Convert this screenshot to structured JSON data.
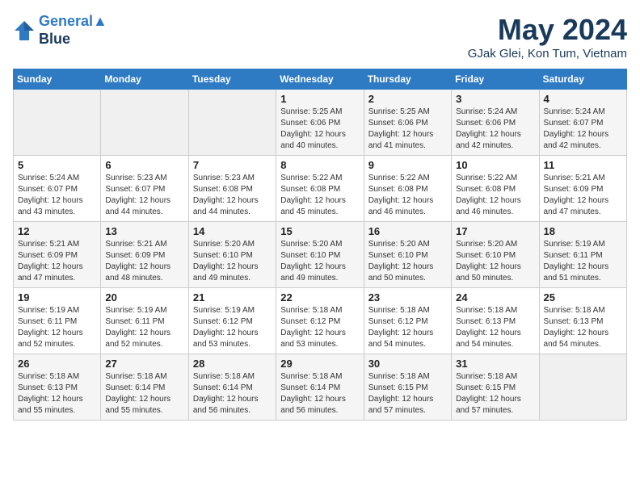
{
  "header": {
    "logo_line1": "General",
    "logo_line2": "Blue",
    "month": "May 2024",
    "location": "GJak Glei, Kon Tum, Vietnam"
  },
  "weekdays": [
    "Sunday",
    "Monday",
    "Tuesday",
    "Wednesday",
    "Thursday",
    "Friday",
    "Saturday"
  ],
  "weeks": [
    [
      {
        "day": "",
        "info": ""
      },
      {
        "day": "",
        "info": ""
      },
      {
        "day": "",
        "info": ""
      },
      {
        "day": "1",
        "info": "Sunrise: 5:25 AM\nSunset: 6:06 PM\nDaylight: 12 hours\nand 40 minutes."
      },
      {
        "day": "2",
        "info": "Sunrise: 5:25 AM\nSunset: 6:06 PM\nDaylight: 12 hours\nand 41 minutes."
      },
      {
        "day": "3",
        "info": "Sunrise: 5:24 AM\nSunset: 6:06 PM\nDaylight: 12 hours\nand 42 minutes."
      },
      {
        "day": "4",
        "info": "Sunrise: 5:24 AM\nSunset: 6:07 PM\nDaylight: 12 hours\nand 42 minutes."
      }
    ],
    [
      {
        "day": "5",
        "info": "Sunrise: 5:24 AM\nSunset: 6:07 PM\nDaylight: 12 hours\nand 43 minutes."
      },
      {
        "day": "6",
        "info": "Sunrise: 5:23 AM\nSunset: 6:07 PM\nDaylight: 12 hours\nand 44 minutes."
      },
      {
        "day": "7",
        "info": "Sunrise: 5:23 AM\nSunset: 6:08 PM\nDaylight: 12 hours\nand 44 minutes."
      },
      {
        "day": "8",
        "info": "Sunrise: 5:22 AM\nSunset: 6:08 PM\nDaylight: 12 hours\nand 45 minutes."
      },
      {
        "day": "9",
        "info": "Sunrise: 5:22 AM\nSunset: 6:08 PM\nDaylight: 12 hours\nand 46 minutes."
      },
      {
        "day": "10",
        "info": "Sunrise: 5:22 AM\nSunset: 6:08 PM\nDaylight: 12 hours\nand 46 minutes."
      },
      {
        "day": "11",
        "info": "Sunrise: 5:21 AM\nSunset: 6:09 PM\nDaylight: 12 hours\nand 47 minutes."
      }
    ],
    [
      {
        "day": "12",
        "info": "Sunrise: 5:21 AM\nSunset: 6:09 PM\nDaylight: 12 hours\nand 47 minutes."
      },
      {
        "day": "13",
        "info": "Sunrise: 5:21 AM\nSunset: 6:09 PM\nDaylight: 12 hours\nand 48 minutes."
      },
      {
        "day": "14",
        "info": "Sunrise: 5:20 AM\nSunset: 6:10 PM\nDaylight: 12 hours\nand 49 minutes."
      },
      {
        "day": "15",
        "info": "Sunrise: 5:20 AM\nSunset: 6:10 PM\nDaylight: 12 hours\nand 49 minutes."
      },
      {
        "day": "16",
        "info": "Sunrise: 5:20 AM\nSunset: 6:10 PM\nDaylight: 12 hours\nand 50 minutes."
      },
      {
        "day": "17",
        "info": "Sunrise: 5:20 AM\nSunset: 6:10 PM\nDaylight: 12 hours\nand 50 minutes."
      },
      {
        "day": "18",
        "info": "Sunrise: 5:19 AM\nSunset: 6:11 PM\nDaylight: 12 hours\nand 51 minutes."
      }
    ],
    [
      {
        "day": "19",
        "info": "Sunrise: 5:19 AM\nSunset: 6:11 PM\nDaylight: 12 hours\nand 52 minutes."
      },
      {
        "day": "20",
        "info": "Sunrise: 5:19 AM\nSunset: 6:11 PM\nDaylight: 12 hours\nand 52 minutes."
      },
      {
        "day": "21",
        "info": "Sunrise: 5:19 AM\nSunset: 6:12 PM\nDaylight: 12 hours\nand 53 minutes."
      },
      {
        "day": "22",
        "info": "Sunrise: 5:18 AM\nSunset: 6:12 PM\nDaylight: 12 hours\nand 53 minutes."
      },
      {
        "day": "23",
        "info": "Sunrise: 5:18 AM\nSunset: 6:12 PM\nDaylight: 12 hours\nand 54 minutes."
      },
      {
        "day": "24",
        "info": "Sunrise: 5:18 AM\nSunset: 6:13 PM\nDaylight: 12 hours\nand 54 minutes."
      },
      {
        "day": "25",
        "info": "Sunrise: 5:18 AM\nSunset: 6:13 PM\nDaylight: 12 hours\nand 54 minutes."
      }
    ],
    [
      {
        "day": "26",
        "info": "Sunrise: 5:18 AM\nSunset: 6:13 PM\nDaylight: 12 hours\nand 55 minutes."
      },
      {
        "day": "27",
        "info": "Sunrise: 5:18 AM\nSunset: 6:14 PM\nDaylight: 12 hours\nand 55 minutes."
      },
      {
        "day": "28",
        "info": "Sunrise: 5:18 AM\nSunset: 6:14 PM\nDaylight: 12 hours\nand 56 minutes."
      },
      {
        "day": "29",
        "info": "Sunrise: 5:18 AM\nSunset: 6:14 PM\nDaylight: 12 hours\nand 56 minutes."
      },
      {
        "day": "30",
        "info": "Sunrise: 5:18 AM\nSunset: 6:15 PM\nDaylight: 12 hours\nand 57 minutes."
      },
      {
        "day": "31",
        "info": "Sunrise: 5:18 AM\nSunset: 6:15 PM\nDaylight: 12 hours\nand 57 minutes."
      },
      {
        "day": "",
        "info": ""
      }
    ]
  ]
}
